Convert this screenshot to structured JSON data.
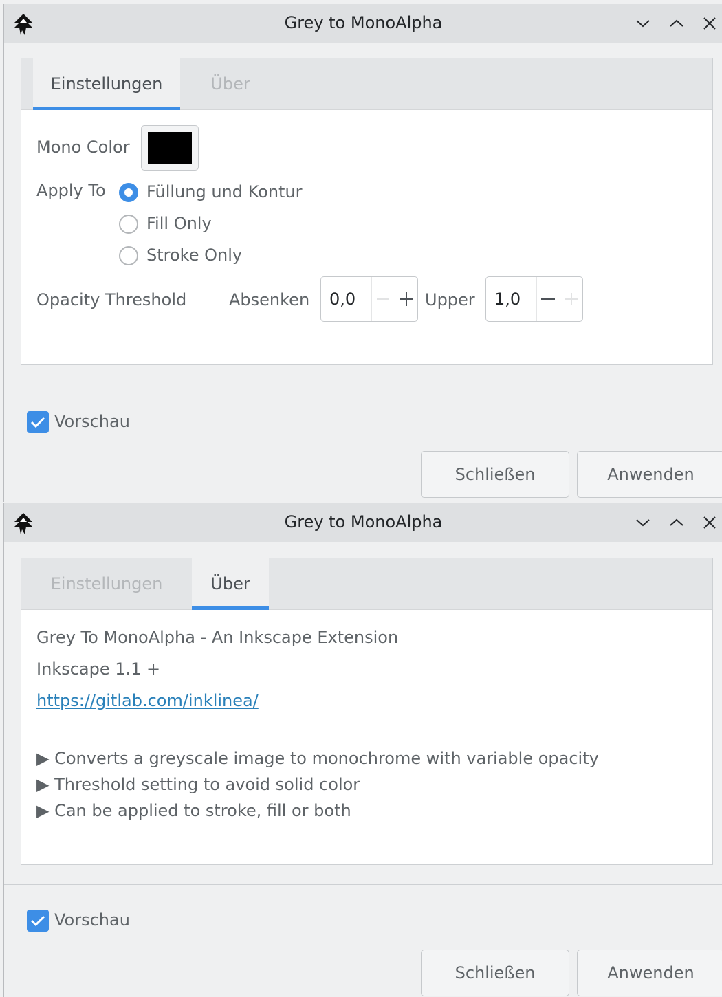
{
  "window_title": "Grey to MonoAlpha",
  "tabs": {
    "settings": "Einstellungen",
    "about": "Über"
  },
  "settings": {
    "mono_color_label": "Mono Color",
    "mono_color_value": "#000000",
    "apply_to_label": "Apply To",
    "apply_to_options": [
      "Füllung und Kontur",
      "Fill Only",
      "Stroke Only"
    ],
    "apply_to_selected": "Füllung und Kontur",
    "opacity_threshold_label": "Opacity Threshold",
    "lower_label": "Absenken",
    "lower_value": "0,0",
    "upper_label": "Upper",
    "upper_value": "1,0"
  },
  "about": {
    "heading": "Grey To MonoAlpha - An Inkscape Extension",
    "version": "Inkscape 1.1 +",
    "link": "https://gitlab.com/inklinea/",
    "bullets": [
      "▶ Converts a greyscale image to monochrome with variable opacity",
      "▶ Threshold setting to avoid solid color",
      "▶ Can be applied to stroke, fill or both"
    ]
  },
  "footer": {
    "preview_label": "Vorschau",
    "preview_checked": true,
    "close_label": "Schließen",
    "apply_label": "Anwenden"
  },
  "colors": {
    "accent": "#3d8ee6",
    "link": "#2980b9"
  }
}
